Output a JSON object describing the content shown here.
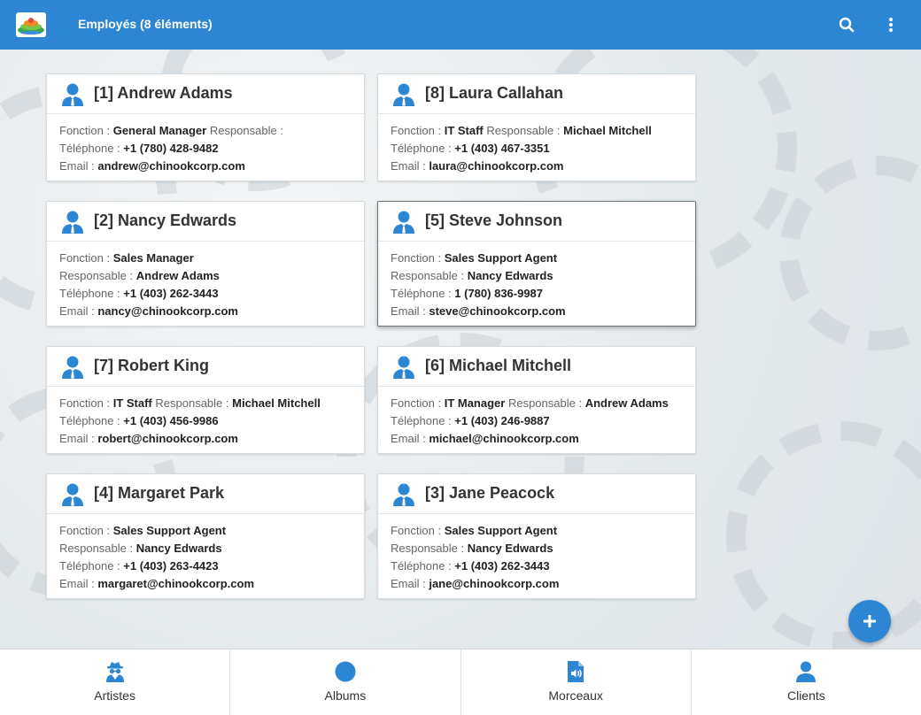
{
  "appbar": {
    "title": "Employés (8 éléments)",
    "search_icon": "search-icon",
    "menu_icon": "more-vert-icon"
  },
  "labels": {
    "fonction": "Fonction : ",
    "responsable": "Responsable : ",
    "telephone": "Téléphone : ",
    "email": "Email : "
  },
  "employees": [
    {
      "title": "[1] Andrew Adams",
      "fonction": "General Manager",
      "responsable": "",
      "telephone": "+1 (780) 428-9482",
      "email": "andrew@chinookcorp.com"
    },
    {
      "title": "[8] Laura Callahan",
      "fonction": "IT Staff",
      "responsable": "Michael Mitchell",
      "telephone": "+1 (403) 467-3351",
      "email": "laura@chinookcorp.com"
    },
    {
      "title": "[2] Nancy Edwards",
      "fonction": "Sales Manager",
      "responsable": "Andrew Adams",
      "telephone": "+1 (403) 262-3443",
      "email": "nancy@chinookcorp.com"
    },
    {
      "title": "[5] Steve Johnson",
      "fonction": "Sales Support Agent",
      "responsable": "Nancy Edwards",
      "telephone": "1 (780) 836-9987",
      "email": "steve@chinookcorp.com"
    },
    {
      "title": "[7] Robert King",
      "fonction": "IT Staff",
      "responsable": "Michael Mitchell",
      "telephone": "+1 (403) 456-9986",
      "email": "robert@chinookcorp.com"
    },
    {
      "title": "[6] Michael Mitchell",
      "fonction": "IT Manager",
      "responsable": "Andrew Adams",
      "telephone": "+1 (403) 246-9887",
      "email": "michael@chinookcorp.com"
    },
    {
      "title": "[4] Margaret Park",
      "fonction": "Sales Support Agent",
      "responsable": "Nancy Edwards",
      "telephone": "+1 (403) 263-4423",
      "email": "margaret@chinookcorp.com"
    },
    {
      "title": "[3] Jane Peacock",
      "fonction": "Sales Support Agent",
      "responsable": "Nancy Edwards",
      "telephone": "+1 (403) 262-3443",
      "email": "jane@chinookcorp.com"
    }
  ],
  "fab": {
    "icon": "plus-icon"
  },
  "bottom_nav": [
    {
      "label": "Artistes",
      "icon": "spy-icon"
    },
    {
      "label": "Albums",
      "icon": "disc-icon"
    },
    {
      "label": "Morceaux",
      "icon": "audio-file-icon"
    },
    {
      "label": "Clients",
      "icon": "user-icon"
    }
  ],
  "colors": {
    "primary": "#2c86d3",
    "text": "#333333"
  }
}
